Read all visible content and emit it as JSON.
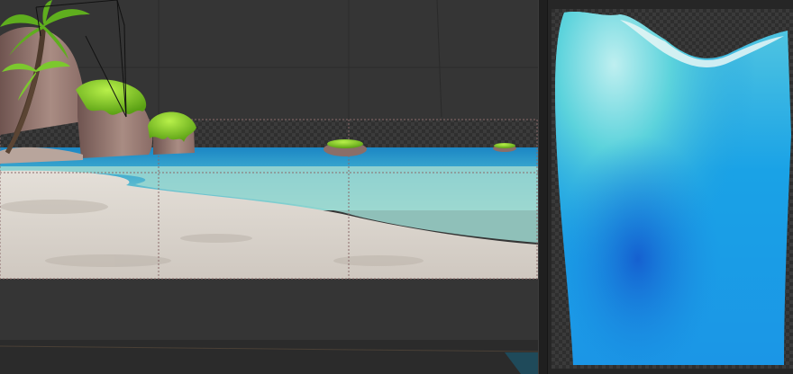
{
  "icons": {
    "palm_tree": "palm-tree-icon",
    "camera_frustum": "camera-frustum-icon"
  },
  "colors": {
    "viewport_bg": "#363636",
    "sand": "#d9d3cc",
    "sea_shallow": "#7fd1cf",
    "sea_deep": "#1e8fc9",
    "moss_green": "#7fc21e",
    "rock": "#9a7c72",
    "texture_light": "#bfeff0",
    "texture_blue": "#1a78d8"
  }
}
